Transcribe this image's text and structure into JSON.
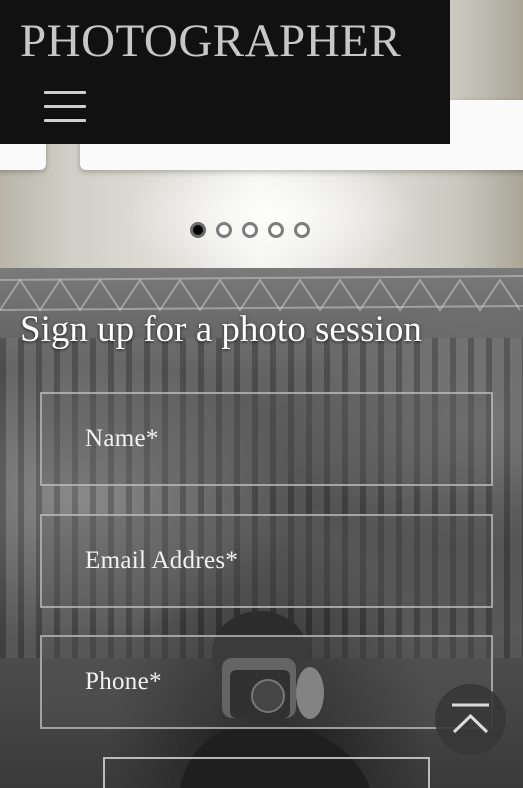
{
  "header": {
    "logo_text": "PHOTOGRAPHER",
    "menu_icon": "hamburger-menu-icon"
  },
  "slider": {
    "dots_count": 5,
    "active_index": 0
  },
  "signup": {
    "title": "Sign up for a photo session",
    "name_placeholder": "Name*",
    "email_placeholder": "Email Addres*",
    "phone_placeholder": "Phone*",
    "submit_label": ""
  },
  "back_to_top": {
    "icon": "chevron-up-icon"
  },
  "colors": {
    "header_bg": "#111111",
    "logo": "#c7c7c7",
    "title": "#ffffff"
  }
}
